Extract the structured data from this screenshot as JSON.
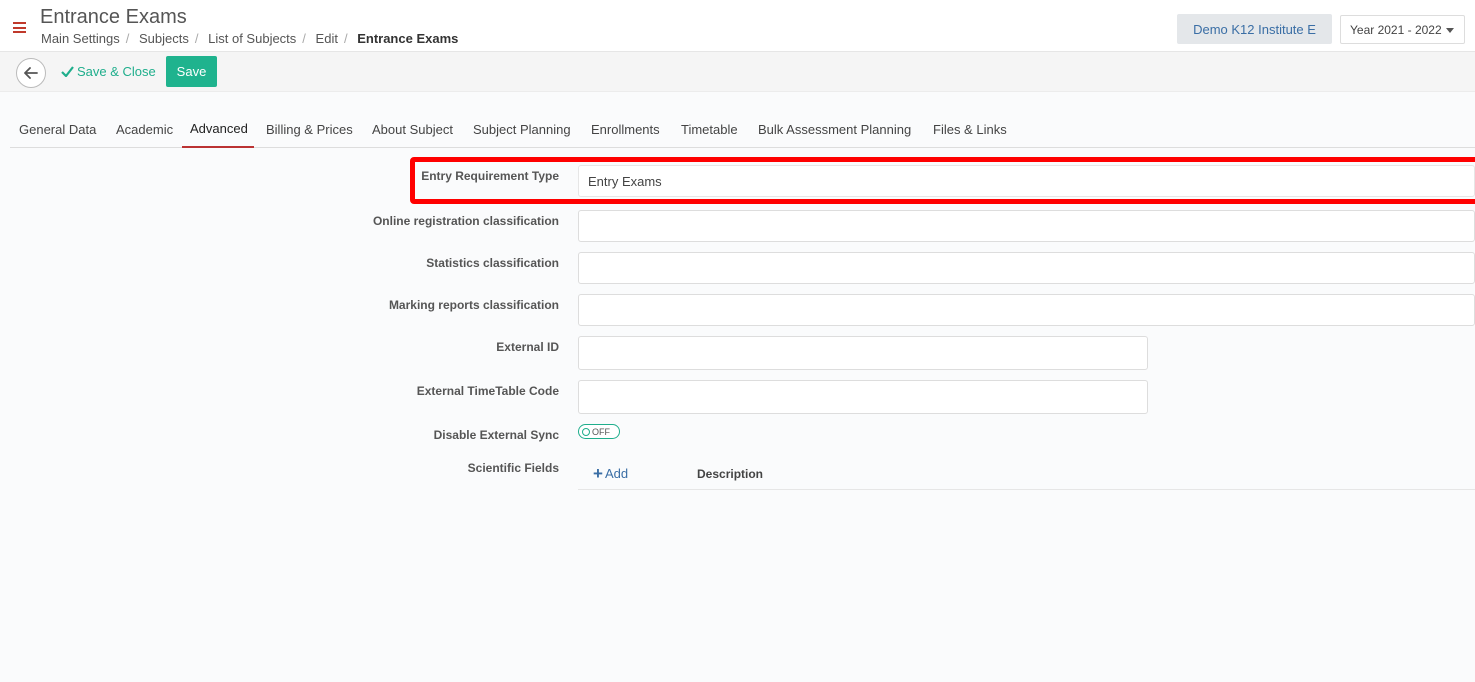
{
  "header": {
    "title": "Entrance Exams",
    "breadcrumb": [
      "Main Settings",
      "Subjects",
      "List of Subjects",
      "Edit",
      "Entrance Exams"
    ],
    "institute": "Demo K12 Institute E",
    "year": "Year 2021 - 2022"
  },
  "toolbar": {
    "save_close_label": "Save & Close",
    "save_label": "Save"
  },
  "tabs": [
    {
      "label": "General Data"
    },
    {
      "label": "Academic"
    },
    {
      "label": "Advanced",
      "active": true
    },
    {
      "label": "Billing & Prices"
    },
    {
      "label": "About Subject"
    },
    {
      "label": "Subject Planning"
    },
    {
      "label": "Enrollments"
    },
    {
      "label": "Timetable"
    },
    {
      "label": "Bulk Assessment Planning"
    },
    {
      "label": "Files & Links"
    }
  ],
  "form": {
    "entry_requirement_type": {
      "label": "Entry Requirement Type",
      "value": "Entry Exams"
    },
    "online_registration_classification": {
      "label": "Online registration classification",
      "value": ""
    },
    "statistics_classification": {
      "label": "Statistics classification",
      "value": ""
    },
    "marking_reports_classification": {
      "label": "Marking reports classification",
      "value": ""
    },
    "external_id": {
      "label": "External ID",
      "value": ""
    },
    "external_timetable_code": {
      "label": "External TimeTable Code",
      "value": ""
    },
    "disable_external_sync": {
      "label": "Disable External Sync",
      "state": "OFF"
    },
    "scientific_fields": {
      "label": "Scientific Fields",
      "add_label": "Add",
      "description_header": "Description"
    }
  },
  "colors": {
    "accent_green": "#1fb38e",
    "highlight_red": "#ff0000",
    "tab_active_underline": "#b33333",
    "link_blue": "#3a6ea5"
  }
}
